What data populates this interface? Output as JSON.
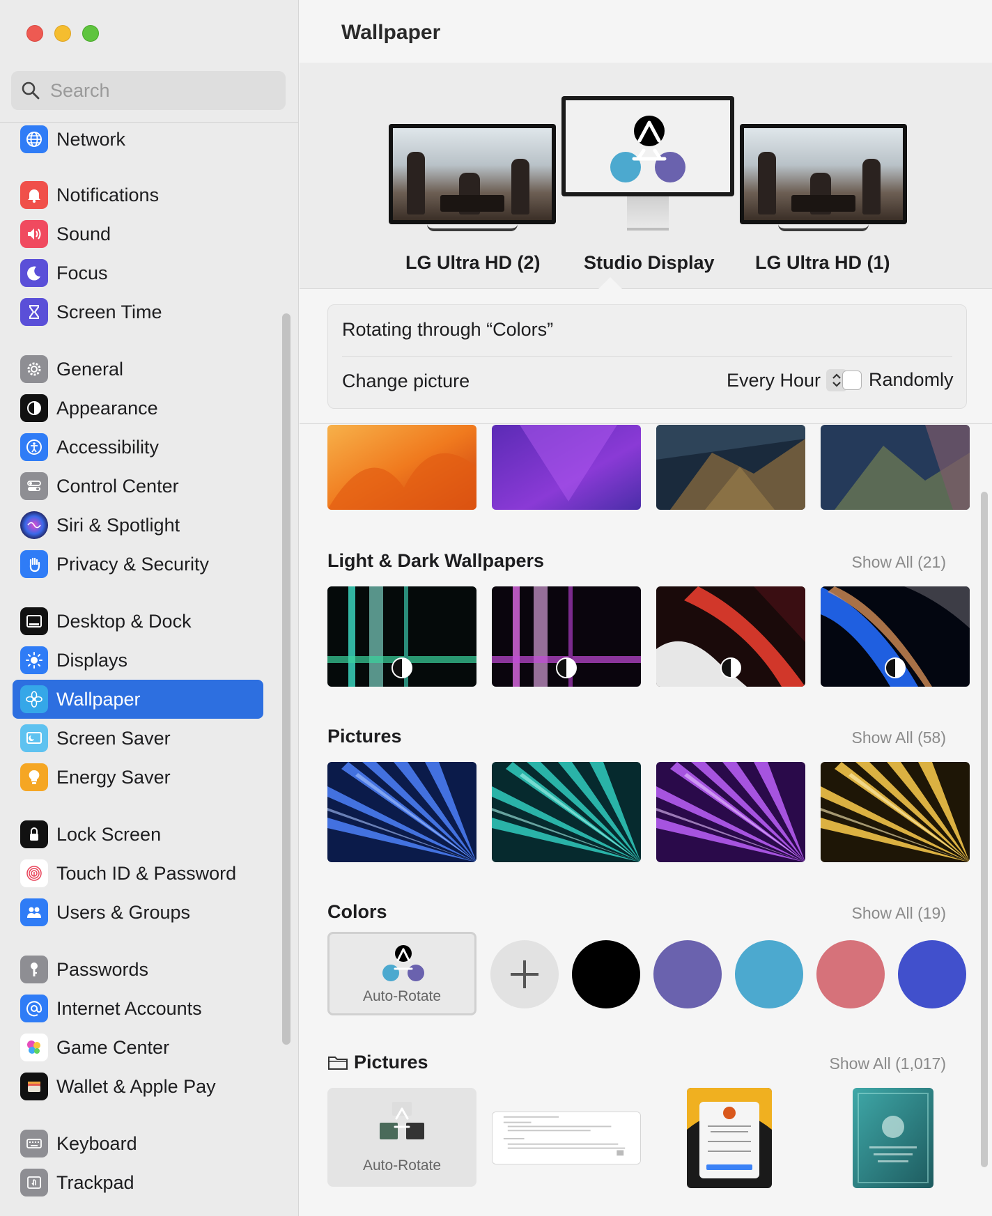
{
  "sidebar": {
    "search_placeholder": "Search",
    "items": [
      {
        "label": "Network",
        "icon": "globe-icon",
        "color": "#2f7cf6"
      },
      {
        "label": "Notifications",
        "icon": "bell-icon",
        "color": "#f0504a"
      },
      {
        "label": "Sound",
        "icon": "speaker-icon",
        "color": "#f04a5f"
      },
      {
        "label": "Focus",
        "icon": "moon-icon",
        "color": "#5a4fd8"
      },
      {
        "label": "Screen Time",
        "icon": "hourglass-icon",
        "color": "#5a4fd8"
      },
      {
        "label": "General",
        "icon": "gear-icon",
        "color": "#8e8e93"
      },
      {
        "label": "Appearance",
        "icon": "appearance-icon",
        "color": "#111111"
      },
      {
        "label": "Accessibility",
        "icon": "accessibility-icon",
        "color": "#2f7cf6"
      },
      {
        "label": "Control Center",
        "icon": "toggles-icon",
        "color": "#8e8e93"
      },
      {
        "label": "Siri & Spotlight",
        "icon": "siri-icon",
        "color": "#3a2c6e"
      },
      {
        "label": "Privacy & Security",
        "icon": "hand-icon",
        "color": "#2f7cf6"
      },
      {
        "label": "Desktop & Dock",
        "icon": "dock-icon",
        "color": "#111111"
      },
      {
        "label": "Displays",
        "icon": "sun-icon",
        "color": "#2f7cf6"
      },
      {
        "label": "Wallpaper",
        "icon": "flower-icon",
        "color": "#35a7e8"
      },
      {
        "label": "Screen Saver",
        "icon": "screensaver-icon",
        "color": "#5ec2f0"
      },
      {
        "label": "Energy Saver",
        "icon": "bulb-icon",
        "color": "#f5a623"
      },
      {
        "label": "Lock Screen",
        "icon": "lock-icon",
        "color": "#111111"
      },
      {
        "label": "Touch ID & Password",
        "icon": "fingerprint-icon",
        "color": "#ffffff"
      },
      {
        "label": "Users & Groups",
        "icon": "users-icon",
        "color": "#2f7cf6"
      },
      {
        "label": "Passwords",
        "icon": "key-icon",
        "color": "#8e8e93"
      },
      {
        "label": "Internet Accounts",
        "icon": "at-icon",
        "color": "#2f7cf6"
      },
      {
        "label": "Game Center",
        "icon": "game-center-icon",
        "color": "#ffffff"
      },
      {
        "label": "Wallet & Apple Pay",
        "icon": "wallet-icon",
        "color": "#111111"
      },
      {
        "label": "Keyboard",
        "icon": "keyboard-icon",
        "color": "#8e8e93"
      },
      {
        "label": "Trackpad",
        "icon": "trackpad-icon",
        "color": "#8e8e93"
      }
    ],
    "selected": "Wallpaper"
  },
  "main": {
    "title": "Wallpaper",
    "displays": [
      {
        "label": "LG Ultra HD (2)"
      },
      {
        "label": "Studio Display"
      },
      {
        "label": "LG Ultra HD (1)"
      }
    ],
    "rotating_label": "Rotating through “Colors”",
    "change_picture_label": "Change picture",
    "interval_value": "Every Hour",
    "randomly_label": "Randomly",
    "sections": {
      "light_dark": {
        "title": "Light & Dark Wallpapers",
        "show_all": "Show All (21)"
      },
      "pictures": {
        "title": "Pictures",
        "show_all": "Show All (58)"
      },
      "colors": {
        "title": "Colors",
        "show_all": "Show All (19)",
        "auto_rotate_label": "Auto-Rotate",
        "swatches": [
          "#000000",
          "#6a62ae",
          "#4ca9cf",
          "#d6727a",
          "#4150cc"
        ]
      },
      "folder": {
        "title": "Pictures",
        "show_all": "Show All (1,017)",
        "auto_rotate_label": "Auto-Rotate"
      }
    },
    "accent_color": "#2d6fe0"
  }
}
